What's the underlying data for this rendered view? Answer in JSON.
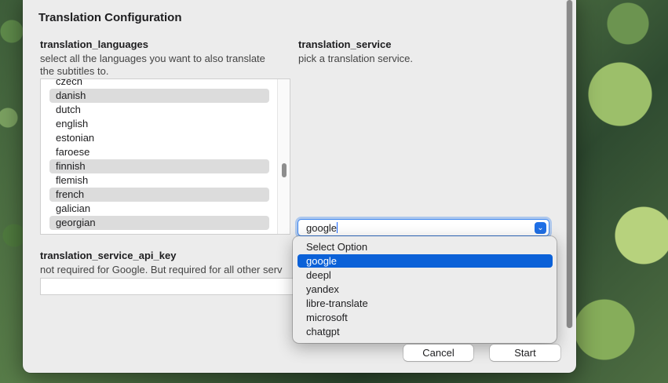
{
  "dialog": {
    "title": "Translation Configuration"
  },
  "languages": {
    "label": "translation_languages",
    "description_line1": "select all the languages you want to also translate",
    "description_line2": "the subtitles to.",
    "items": [
      {
        "label": "czech",
        "selected": false
      },
      {
        "label": "danish",
        "selected": true
      },
      {
        "label": "dutch",
        "selected": false
      },
      {
        "label": "english",
        "selected": false
      },
      {
        "label": "estonian",
        "selected": false
      },
      {
        "label": "faroese",
        "selected": false
      },
      {
        "label": "finnish",
        "selected": true
      },
      {
        "label": "flemish",
        "selected": false
      },
      {
        "label": "french",
        "selected": true
      },
      {
        "label": "galician",
        "selected": false
      },
      {
        "label": "georgian",
        "selected": true
      }
    ]
  },
  "service": {
    "label": "translation_service",
    "description": "pick a translation service.",
    "value": "google",
    "options": [
      "Select Option",
      "google",
      "deepl",
      "yandex",
      "libre-translate",
      "microsoft",
      "chatgpt"
    ],
    "highlighted": "google"
  },
  "api_key": {
    "label": "translation_service_api_key",
    "description": "not required for Google. But required for all other serv",
    "value": ""
  },
  "buttons": {
    "cancel": "Cancel",
    "start": "Start"
  },
  "icons": {
    "dropdown_arrow": "chevron-down-icon"
  },
  "colors": {
    "accent": "#0b61d8",
    "selection_gray": "#dcdcdc"
  }
}
